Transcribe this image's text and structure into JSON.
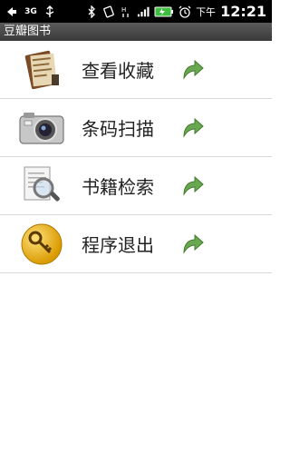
{
  "status_bar": {
    "network": "3G",
    "ampm": "下午",
    "time": "12:21"
  },
  "app": {
    "title": "豆瓣图书"
  },
  "menu": [
    {
      "label": "查看收藏",
      "icon": "book-collection-icon"
    },
    {
      "label": "条码扫描",
      "icon": "camera-icon"
    },
    {
      "label": "书籍检索",
      "icon": "magnifier-document-icon"
    },
    {
      "label": "程序退出",
      "icon": "key-icon"
    }
  ],
  "colors": {
    "arrow": "#6aa84f",
    "appbar": "#4a4a4a",
    "divider": "#d8d8d8"
  }
}
